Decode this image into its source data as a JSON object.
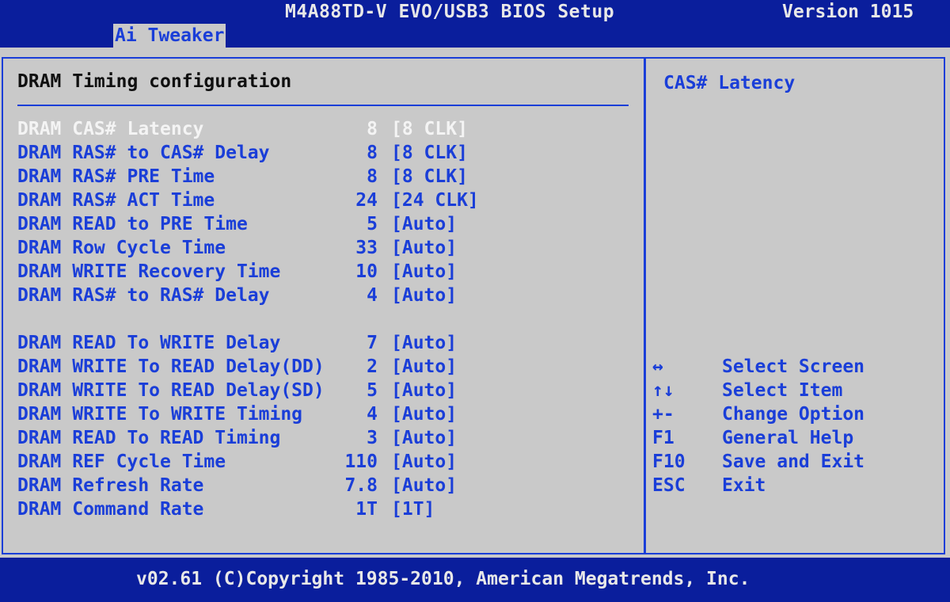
{
  "header": {
    "title": "M4A88TD-V EVO/USB3 BIOS Setup",
    "version": "Version 1015"
  },
  "tabs": [
    {
      "label": "Ai Tweaker",
      "active": true
    }
  ],
  "section": {
    "title": "DRAM Timing configuration"
  },
  "settings": [
    {
      "label": "DRAM CAS# Latency",
      "value": "8",
      "option": "[8 CLK]",
      "selected": true
    },
    {
      "label": "DRAM RAS# to CAS# Delay",
      "value": "8",
      "option": "[8 CLK]"
    },
    {
      "label": "DRAM RAS# PRE Time",
      "value": "8",
      "option": "[8 CLK]"
    },
    {
      "label": "DRAM RAS# ACT Time",
      "value": "24",
      "option": "[24 CLK]"
    },
    {
      "label": "DRAM READ to PRE Time",
      "value": "5",
      "option": "[Auto]"
    },
    {
      "label": "DRAM Row Cycle Time",
      "value": "33",
      "option": "[Auto]"
    },
    {
      "label": "DRAM WRITE Recovery Time",
      "value": "10",
      "option": "[Auto]"
    },
    {
      "label": "DRAM RAS# to RAS# Delay",
      "value": "4",
      "option": "[Auto]"
    },
    {
      "label": "DRAM READ To WRITE Delay",
      "value": "7",
      "option": "[Auto]"
    },
    {
      "label": "DRAM WRITE To READ Delay(DD)",
      "value": "2",
      "option": "[Auto]"
    },
    {
      "label": "DRAM WRITE To READ Delay(SD)",
      "value": "5",
      "option": "[Auto]"
    },
    {
      "label": "DRAM WRITE To WRITE Timing",
      "value": "4",
      "option": "[Auto]"
    },
    {
      "label": "DRAM READ To READ Timing",
      "value": "3",
      "option": "[Auto]"
    },
    {
      "label": "DRAM REF Cycle Time",
      "value": "110",
      "option": "[Auto]"
    },
    {
      "label": "DRAM Refresh Rate",
      "value": "7.8",
      "option": "[Auto]"
    },
    {
      "label": "DRAM Command Rate",
      "value": "1T",
      "option": "[1T]"
    }
  ],
  "help": {
    "title": "CAS# Latency"
  },
  "keys": [
    {
      "key": "↔",
      "desc": "Select Screen"
    },
    {
      "key": "↑↓",
      "desc": "Select Item"
    },
    {
      "key": "+-",
      "desc": "Change Option"
    },
    {
      "key": "F1",
      "desc": "General Help"
    },
    {
      "key": "F10",
      "desc": "Save and Exit"
    },
    {
      "key": "ESC",
      "desc": "Exit"
    }
  ],
  "footer": {
    "text": "v02.61 (C)Copyright 1985-2010, American Megatrends, Inc."
  },
  "colors": {
    "background_blue": "#0a1e9c",
    "panel_gray": "#c9c9c9",
    "accent_blue": "#1a3ed8",
    "highlight_white": "#f4f4f4"
  }
}
